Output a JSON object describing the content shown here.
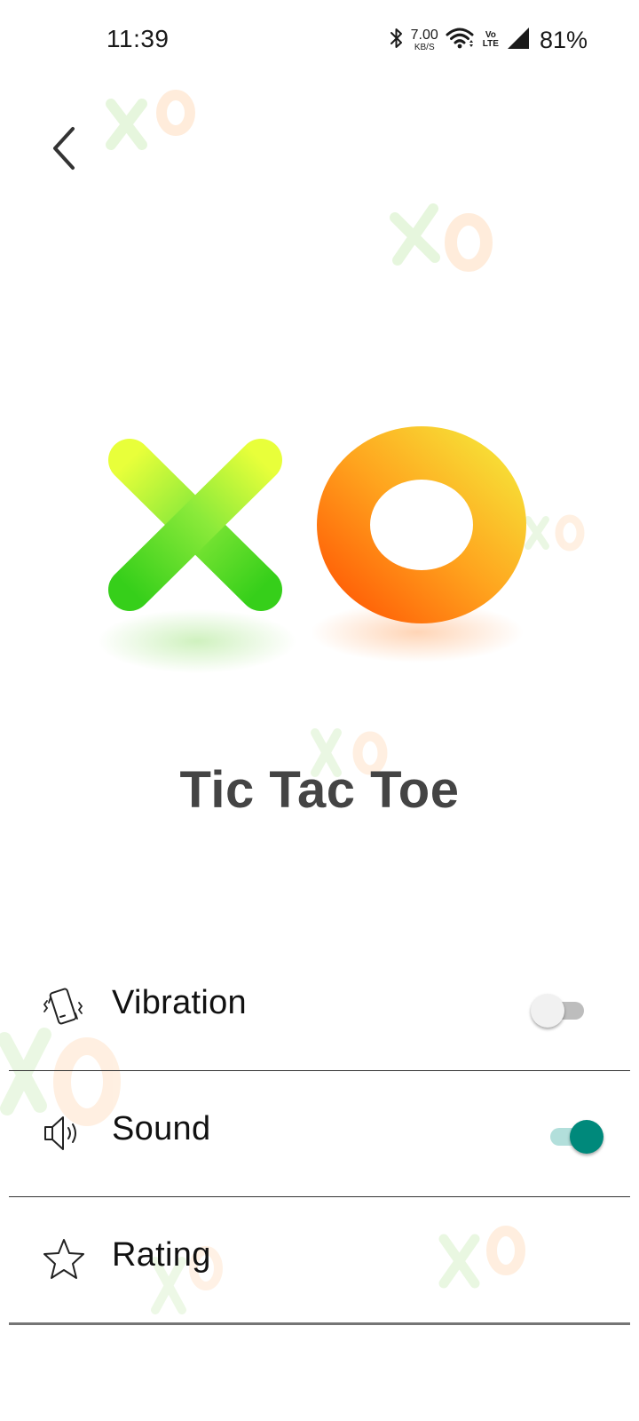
{
  "status_bar": {
    "time": "11:39",
    "net_speed_value": "7.00",
    "net_speed_unit": "KB/S",
    "volte_top": "Vo",
    "volte_bottom": "LTE",
    "battery": "81%"
  },
  "header": {
    "back_icon": "chevron-left-icon"
  },
  "app": {
    "title": "Tic Tac Toe"
  },
  "settings": [
    {
      "label": "Vibration",
      "icon": "vibration-icon",
      "enabled": false
    },
    {
      "label": "Sound",
      "icon": "speaker-icon",
      "enabled": true
    },
    {
      "label": "Rating",
      "icon": "star-icon"
    }
  ],
  "colors": {
    "accent": "#00897B",
    "accent_track": "#B2DFDB",
    "toggle_off_thumb": "#F1F1F1",
    "toggle_off_track": "#BDBDBD",
    "title": "#444444",
    "x_green": "#66D93A",
    "o_orange": "#FF8A1C"
  }
}
